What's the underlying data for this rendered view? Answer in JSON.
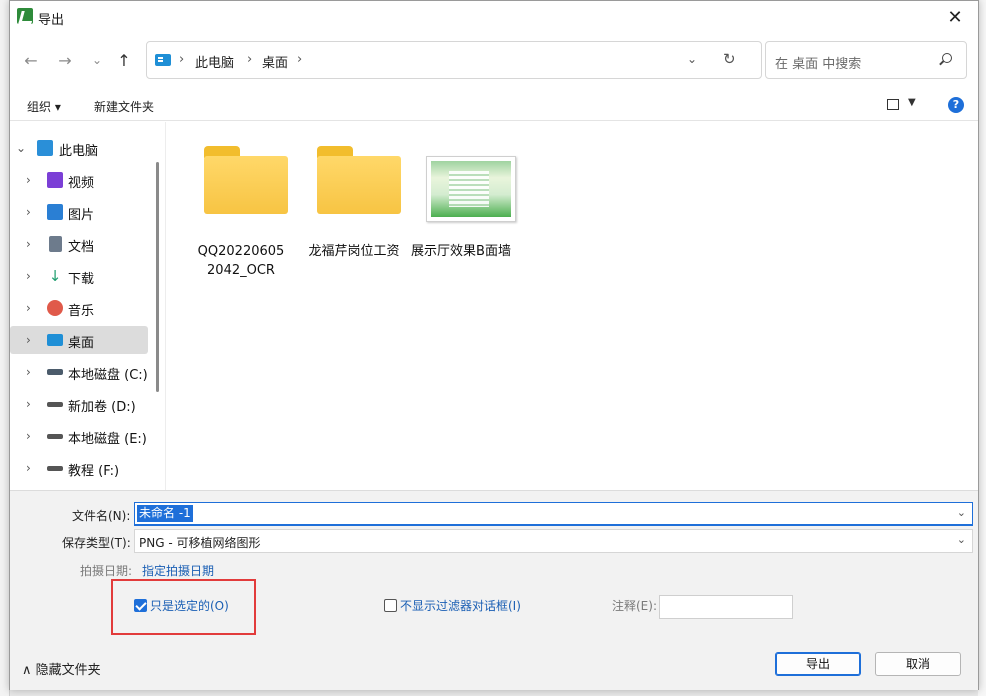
{
  "window": {
    "title": "导出",
    "close_glyph": "✕"
  },
  "nav": {
    "back_glyph": "←",
    "forward_glyph": "→",
    "recent_glyph": "⌄",
    "up_glyph": "↑",
    "crumbs": [
      "此电脑",
      "桌面"
    ],
    "crumb_sep": "›",
    "dropdown_glyph": "⌄",
    "refresh_glyph": "↻",
    "search_placeholder": "在 桌面 中搜索"
  },
  "toolbar": {
    "organize": "组织 ▾",
    "new_folder": "新建文件夹",
    "view_drop": "▼",
    "help": "?"
  },
  "sidebar": {
    "root": {
      "label": "此电脑",
      "chevron": "⌄"
    },
    "items": [
      {
        "label": "视频",
        "chevron": "›",
        "color": "#7b3fd6"
      },
      {
        "label": "图片",
        "chevron": "›",
        "color": "#2a7fd4"
      },
      {
        "label": "文档",
        "chevron": "›",
        "color": "#6d7b8c"
      },
      {
        "label": "下载",
        "chevron": "›",
        "color": "#1f9e6f"
      },
      {
        "label": "音乐",
        "chevron": "›",
        "color": "#e05a4a"
      },
      {
        "label": "桌面",
        "chevron": "›",
        "color": "#1f8fd6"
      },
      {
        "label": "本地磁盘 (C:)",
        "chevron": "›",
        "color": "#4b5b6b"
      },
      {
        "label": "新加卷 (D:)",
        "chevron": "›",
        "color": "#555555"
      },
      {
        "label": "本地磁盘 (E:)",
        "chevron": "›",
        "color": "#555555"
      },
      {
        "label": "教程 (F:)",
        "chevron": "›",
        "color": "#555555"
      }
    ]
  },
  "files": [
    {
      "label": "QQ20220605 2042_OCR",
      "kind": "folder"
    },
    {
      "label": "龙福芹岗位工资",
      "kind": "folder"
    },
    {
      "label": "展示厅效果B面墙",
      "kind": "image"
    }
  ],
  "form": {
    "filename_label": "文件名(N):",
    "filename_value": "未命名 -1",
    "filetype_label": "保存类型(T):",
    "filetype_value": "PNG - 可移植网络图形",
    "date_label": "拍摄日期:",
    "date_link": "指定拍摄日期",
    "only_selected": "只是选定的(O)",
    "no_filter_dialog": "不显示过滤器对话框(I)",
    "note_label": "注释(E):",
    "drop_glyph": "⌄"
  },
  "footer": {
    "hide_folders": "隐藏文件夹",
    "hide_glyph": "∧",
    "export": "导出",
    "cancel": "取消"
  }
}
